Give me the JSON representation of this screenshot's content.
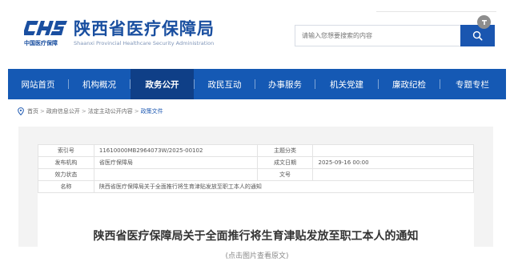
{
  "header": {
    "logo_sub": "中国医疗保障",
    "title": "陕西省医疗保障局",
    "subtitle": "Shaanxi Provincial Healthcare Security Administration",
    "logo_icon": "chs-logo-icon",
    "brand_color": "#1a4fa0"
  },
  "search": {
    "placeholder": "请输入您想要搜索的内容",
    "button_icon": "search-icon"
  },
  "nav": {
    "items": [
      {
        "label": "网站首页"
      },
      {
        "label": "机构概况"
      },
      {
        "label": "政务公开"
      },
      {
        "label": "政民互动"
      },
      {
        "label": "办事服务"
      },
      {
        "label": "机关党建"
      },
      {
        "label": "廉政纪检"
      },
      {
        "label": "专题专栏"
      }
    ],
    "active": "政务公开",
    "bg_color": "#1559b4",
    "active_color": "#0f3f87"
  },
  "breadcrumb": {
    "icon": "location-pin-icon",
    "items": [
      "首页",
      "政府信息公开",
      "法定主动公开内容",
      "政策文件"
    ]
  },
  "meta": {
    "index_label": "索引号",
    "index_value": "11610000MB2964073W/2025-00102",
    "topic_label": "主题分类",
    "topic_value": "",
    "issuer_label": "发布机构",
    "issuer_value": "省医疗保障局",
    "date_label": "成文日期",
    "date_value": "2025-09-16 00:00",
    "status_label": "效力状态",
    "status_value": "",
    "docno_label": "文号",
    "docno_value": "",
    "name_label": "名称",
    "name_value": "陕西省医疗保障局关于全面推行将生育津贴发放至职工本人的通知"
  },
  "doc_title": "陕西省医疗保障局关于全面推行将生育津贴发放至职工本人的通知",
  "caption": "(点击图片查看原文)"
}
